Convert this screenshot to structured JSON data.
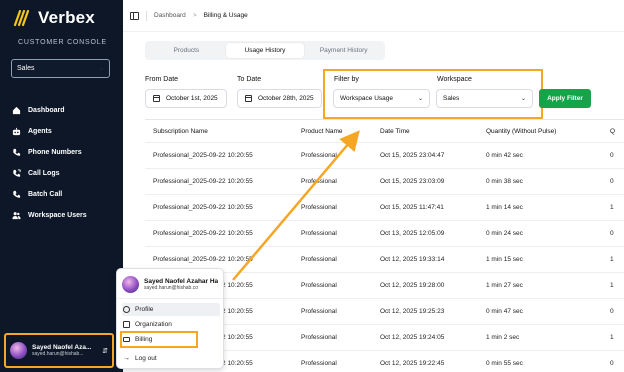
{
  "brand": {
    "name": "Verbex",
    "subtitle": "CUSTOMER CONSOLE"
  },
  "sidebar": {
    "workspace_selected": "Sales",
    "nav": [
      {
        "label": "Dashboard",
        "icon": "home-icon"
      },
      {
        "label": "Agents",
        "icon": "bot-icon"
      },
      {
        "label": "Phone Numbers",
        "icon": "phone-icon"
      },
      {
        "label": "Call Logs",
        "icon": "call-log-icon"
      },
      {
        "label": "Batch Call",
        "icon": "batch-phone-icon"
      },
      {
        "label": "Workspace Users",
        "icon": "users-icon"
      }
    ],
    "user": {
      "name": "Sayed Naofel Aza...",
      "email": "sayed.harun@hishab..."
    }
  },
  "breadcrumb": {
    "first": "Dashboard",
    "separator": ">",
    "current": "Billing & Usage"
  },
  "tabs": [
    "Products",
    "Usage History",
    "Payment History"
  ],
  "active_tab": "Usage History",
  "filters": {
    "from_label": "From Date",
    "from_value": "October 1st, 2025",
    "to_label": "To Date",
    "to_value": "October 28th, 2025",
    "filter_by_label": "Filter by",
    "filter_by_value": "Workspace Usage",
    "workspace_label": "Workspace",
    "workspace_value": "Sales",
    "apply_label": "Apply Filter"
  },
  "table": {
    "headers": [
      "Subscription Name",
      "Product Name",
      "Date Time",
      "Quantity (Without Pulse)",
      "Q"
    ],
    "rows": [
      [
        "Professional_2025-09-22 10:20:55",
        "Professional",
        "Oct 15, 2025 23:04:47",
        "0 min 42 sec",
        "0"
      ],
      [
        "Professional_2025-09-22 10:20:55",
        "Professional",
        "Oct 15, 2025 23:03:09",
        "0 min 38 sec",
        "0"
      ],
      [
        "Professional_2025-09-22 10:20:55",
        "Professional",
        "Oct 15, 2025 11:47:41",
        "1 min 14 sec",
        "1"
      ],
      [
        "Professional_2025-09-22 10:20:55",
        "Professional",
        "Oct 13, 2025 12:05:09",
        "0 min 24 sec",
        "0"
      ],
      [
        "Professional_2025-09-22 10:20:55",
        "Professional",
        "Oct 12, 2025 19:33:14",
        "1 min 15 sec",
        "1"
      ],
      [
        "Professional_2025-09-22 10:20:55",
        "Professional",
        "Oct 12, 2025 19:28:00",
        "1 min 27 sec",
        "1"
      ],
      [
        "Professional_2025-09-22 10:20:55",
        "Professional",
        "Oct 12, 2025 19:25:23",
        "0 min 47 sec",
        "0"
      ],
      [
        "Professional_2025-09-22 10:20:55",
        "Professional",
        "Oct 12, 2025 19:24:05",
        "1 min 2 sec",
        "1"
      ],
      [
        "Professional_2025-09-22 10:20:55",
        "Professional",
        "Oct 12, 2025 19:22:45",
        "0 min 55 sec",
        "0"
      ]
    ]
  },
  "popup": {
    "name": "Sayed Naofel Azahar Ha...",
    "email": "sayed.harun@hishab.co",
    "items": [
      {
        "label": "Profile",
        "icon": "user-circle-icon"
      },
      {
        "label": "Organization",
        "icon": "building-icon"
      },
      {
        "label": "Billing",
        "icon": "credit-card-icon"
      },
      {
        "label": "Log out",
        "icon": "logout-icon"
      }
    ]
  },
  "colors": {
    "sidebar_bg": "#0d1727",
    "highlight": "#f5a623",
    "apply_button": "#16a34a"
  }
}
